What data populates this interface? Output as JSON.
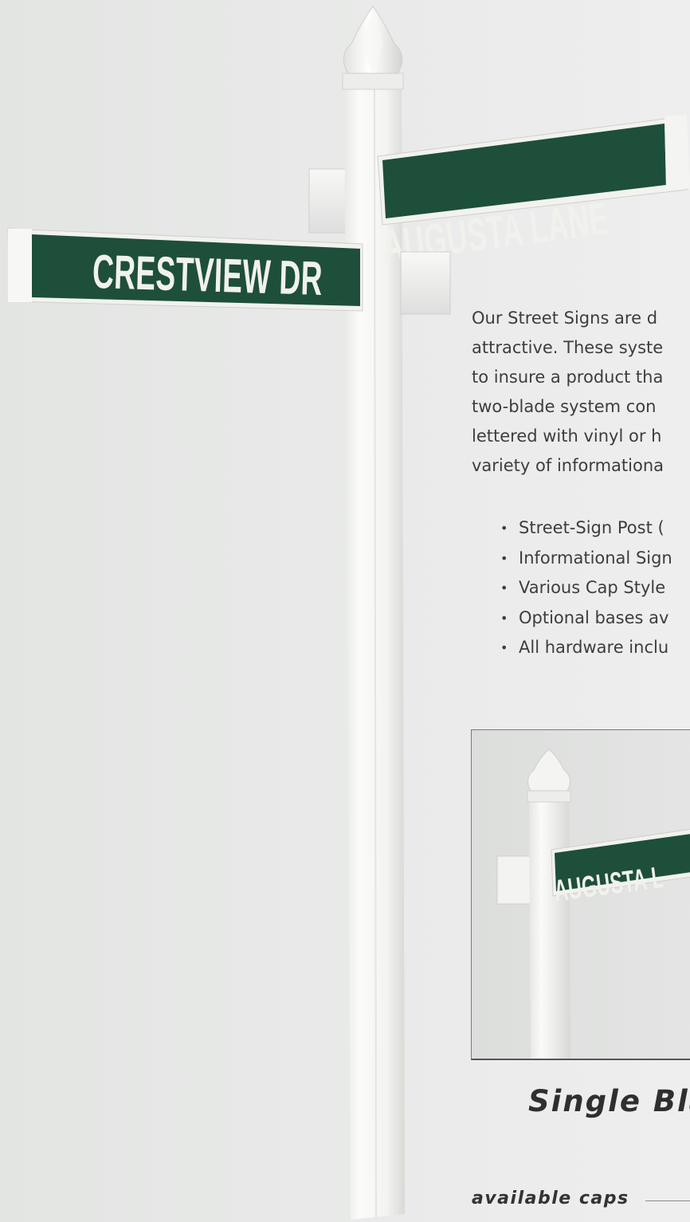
{
  "signs": {
    "main_upper": "AUGUSTA LANE",
    "main_lower": "CRESTVIEW DR",
    "inset_blade": "AUGUSTA L"
  },
  "description": {
    "lines": [
      "Our Street Signs are d",
      "attractive. These syste",
      "to insure a product tha",
      "two-blade system con",
      "lettered with vinyl or h",
      "variety of informationa"
    ]
  },
  "features": [
    "Street-Sign Post (",
    "Informational Sign",
    "Various Cap Style",
    "Optional bases av",
    "All hardware inclu"
  ],
  "bullet_glyph": "•",
  "inset": {
    "caption": "Single Bla"
  },
  "caps": {
    "label": "available caps"
  },
  "colors": {
    "sign_green": "#1e4f3a",
    "sign_letter": "#f1f1ed",
    "post_white": "#f7f7f5",
    "background": "#e6e7e6"
  }
}
